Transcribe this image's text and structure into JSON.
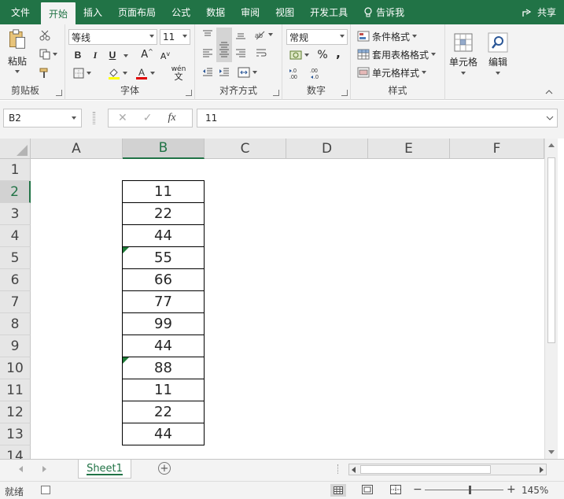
{
  "menu": {
    "tabs": [
      "文件",
      "开始",
      "插入",
      "页面布局",
      "公式",
      "数据",
      "审阅",
      "视图",
      "开发工具"
    ],
    "active_index": 1,
    "tell_me": "告诉我",
    "share": "共享"
  },
  "ribbon": {
    "clipboard": {
      "paste": "粘贴",
      "label": "剪贴板"
    },
    "font": {
      "font_name": "等线",
      "font_size": "11",
      "bold": "B",
      "italic": "I",
      "underline": "U",
      "grow": "A",
      "shrink": "A",
      "wen": "wén",
      "label": "字体"
    },
    "alignment": {
      "label": "对齐方式"
    },
    "number": {
      "format": "常规",
      "percent": "%",
      "comma": ",",
      "label": "数字"
    },
    "styles": {
      "conditional": "条件格式",
      "table": "套用表格格式",
      "cell_styles": "单元格样式",
      "label": "样式"
    },
    "cells": {
      "label": "单元格"
    },
    "editing": {
      "label": "编辑"
    }
  },
  "formula_bar": {
    "name_box": "B2",
    "fx": "fx",
    "formula": "11"
  },
  "grid": {
    "columns": [
      "A",
      "B",
      "C",
      "D",
      "E",
      "F"
    ],
    "selected_column": "B",
    "rows": [
      "1",
      "2",
      "3",
      "4",
      "5",
      "6",
      "7",
      "8",
      "9",
      "10",
      "11",
      "12",
      "13",
      "14"
    ],
    "selected_row": "2",
    "b_values": [
      "11",
      "22",
      "44",
      "55",
      "66",
      "77",
      "99",
      "44",
      "88",
      "11",
      "22",
      "44"
    ],
    "text_number_rows": [
      "5",
      "10"
    ]
  },
  "sheets": {
    "tabs": [
      "Sheet1"
    ],
    "add": "+"
  },
  "status": {
    "ready": "就绪",
    "zoom": "145%",
    "minus": "−",
    "plus": "+"
  },
  "colors": {
    "brand": "#217346",
    "error_indicator": "#1d7a37"
  }
}
